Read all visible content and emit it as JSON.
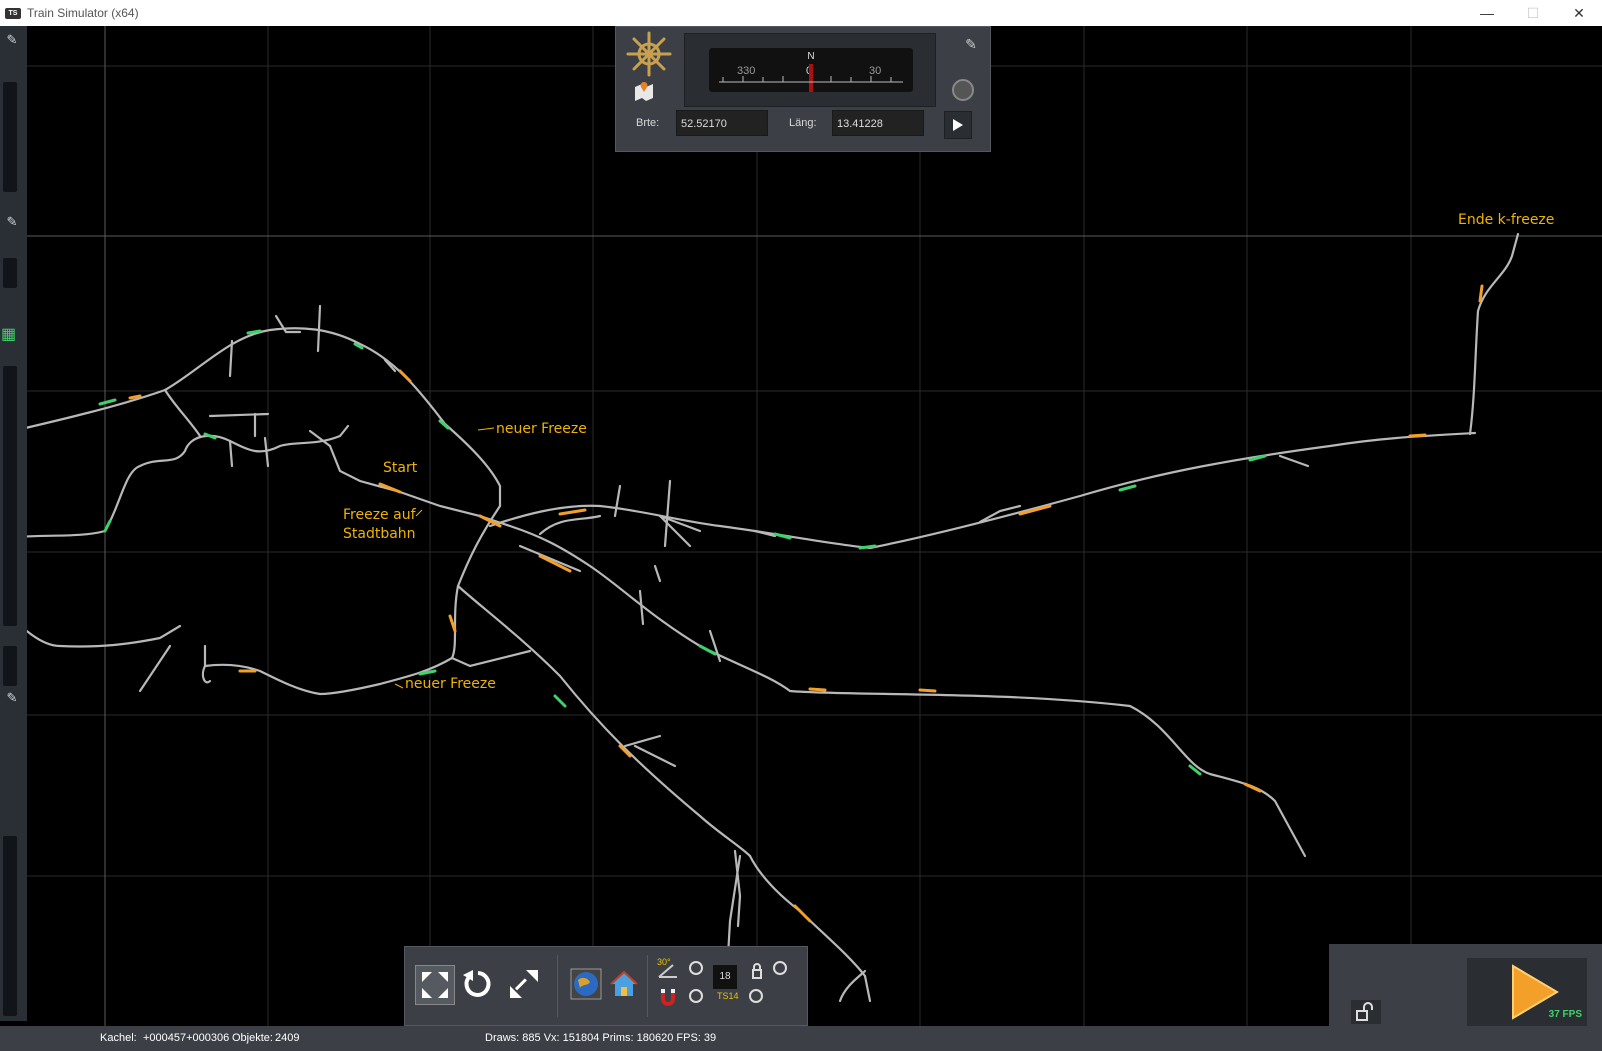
{
  "window": {
    "title": "Train Simulator (x64)",
    "app_icon_text": "TS",
    "controls": {
      "minimize": "—",
      "maximize": "☐",
      "close": "✕"
    }
  },
  "nav_panel": {
    "compass": {
      "north": "N",
      "heading_left": "330",
      "heading_center": "0",
      "heading_right": "30"
    },
    "latitude_label": "Brte:",
    "latitude_value": "52.52170",
    "longitude_label": "Läng:",
    "longitude_value": "13.41228",
    "icons": [
      "compass-wheel-icon",
      "map-icon",
      "pin-icon",
      "target-icon",
      "play-arrow-icon"
    ]
  },
  "annotations": {
    "ende": "Ende k-freeze",
    "neuer_freeze_1": "neuer Freeze",
    "start": "Start",
    "freeze_auf_1": "Freeze auf",
    "freeze_auf_2": "Stadtbahn",
    "neuer_freeze_2": "neuer Freeze"
  },
  "toolbar": {
    "buttons": [
      "fit-view-icon",
      "rotate-icon",
      "expand-icon",
      "globe-icon",
      "home-icon"
    ],
    "angle_label": "30°",
    "ts_label": "TS14",
    "number": "18"
  },
  "status": {
    "kachel_label": "Kachel:",
    "kachel_value": "+000457+000306",
    "objekte_label": "Objekte:",
    "objekte_value": "2409",
    "draws_text": "Draws: 885 Vx: 151804 Prims: 180620 FPS: 39"
  },
  "play_panel": {
    "fps": "37 FPS"
  },
  "colors": {
    "track": "#b8b8b8",
    "annotation": "#f0b400",
    "green": "#3ed36a",
    "orange": "#f2a02a",
    "panel": "#3c4046"
  }
}
